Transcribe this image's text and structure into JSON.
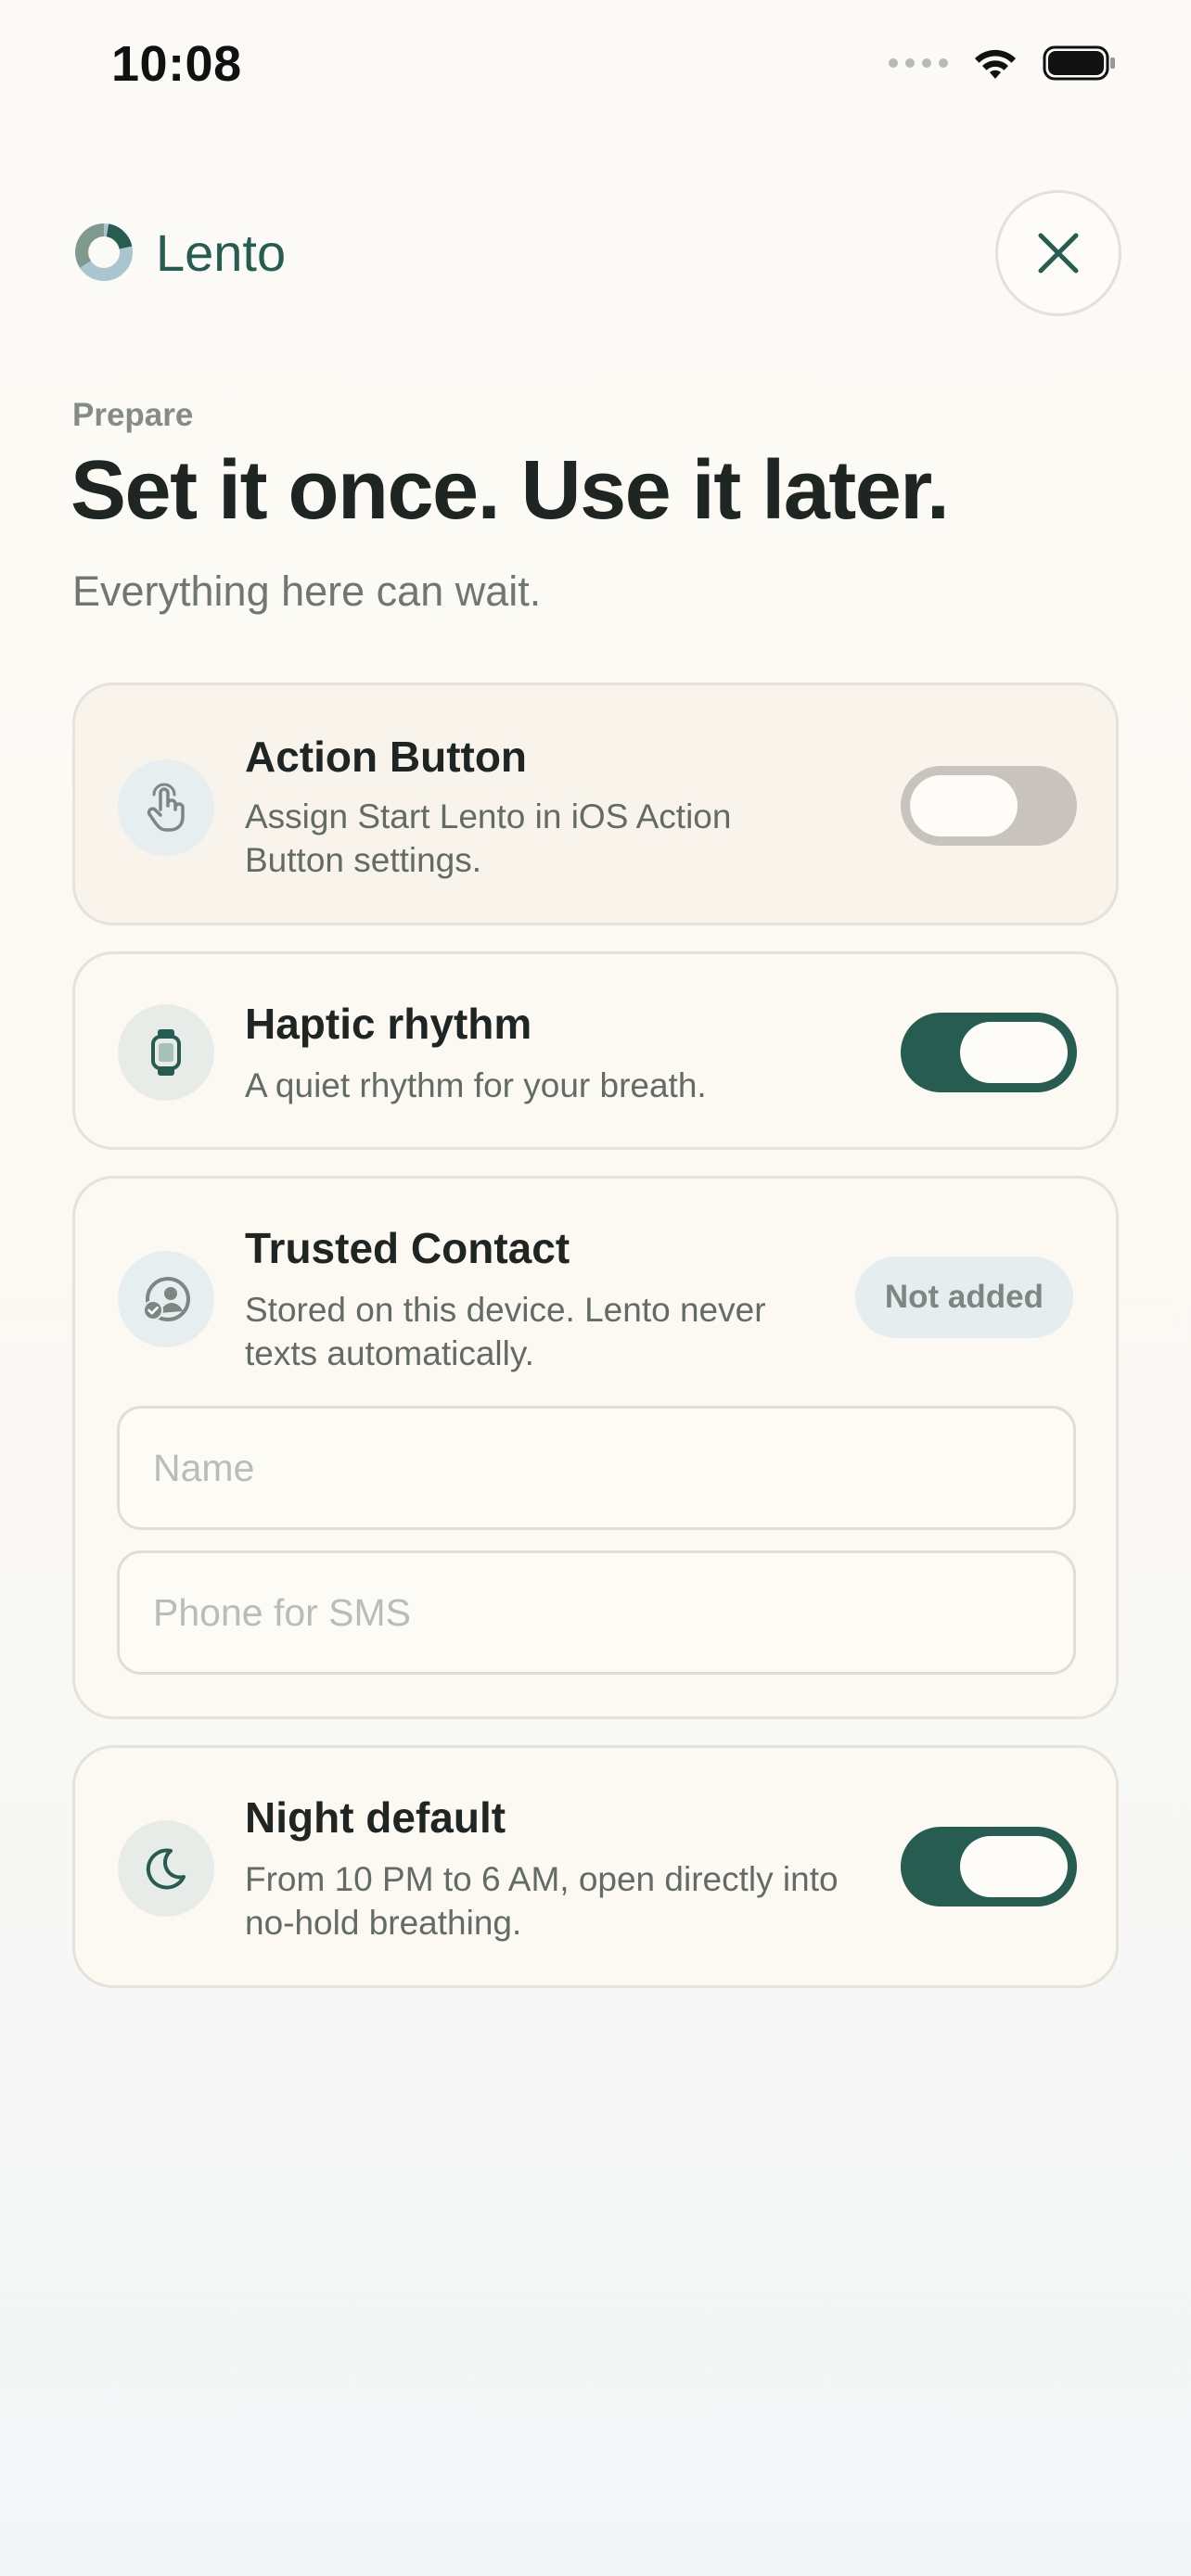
{
  "status_bar": {
    "time": "10:08"
  },
  "header": {
    "brand_name": "Lento",
    "close_icon": "close-icon"
  },
  "hero": {
    "eyebrow": "Prepare",
    "title": "Set it once. Use it later.",
    "subtitle": "Everything here can wait."
  },
  "cards": {
    "action_button": {
      "icon": "hand-tap-icon",
      "title": "Action Button",
      "desc_line1": "Assign Start Lento in iOS Action",
      "desc_line2": "Button settings.",
      "enabled": false
    },
    "haptic": {
      "icon": "watch-icon",
      "title": "Haptic rhythm",
      "desc": "A quiet rhythm for your breath.",
      "enabled": true
    },
    "trusted_contact": {
      "icon": "contact-check-icon",
      "title": "Trusted Contact",
      "desc_line1": "Stored on this device. Lento never",
      "desc_line2": "texts automatically.",
      "badge": "Not added",
      "name_placeholder": "Name",
      "phone_placeholder": "Phone for SMS"
    },
    "night_default": {
      "icon": "moon-icon",
      "title": "Night default",
      "desc_line1": "From 10 PM to 6 AM, open directly into",
      "desc_line2": "no-hold breathing.",
      "enabled": true
    }
  },
  "colors": {
    "accent": "#275d51",
    "toggle_off": "#c8c3bd",
    "card_border": "#e6e2d9",
    "badge_bg": "#e6edee"
  }
}
